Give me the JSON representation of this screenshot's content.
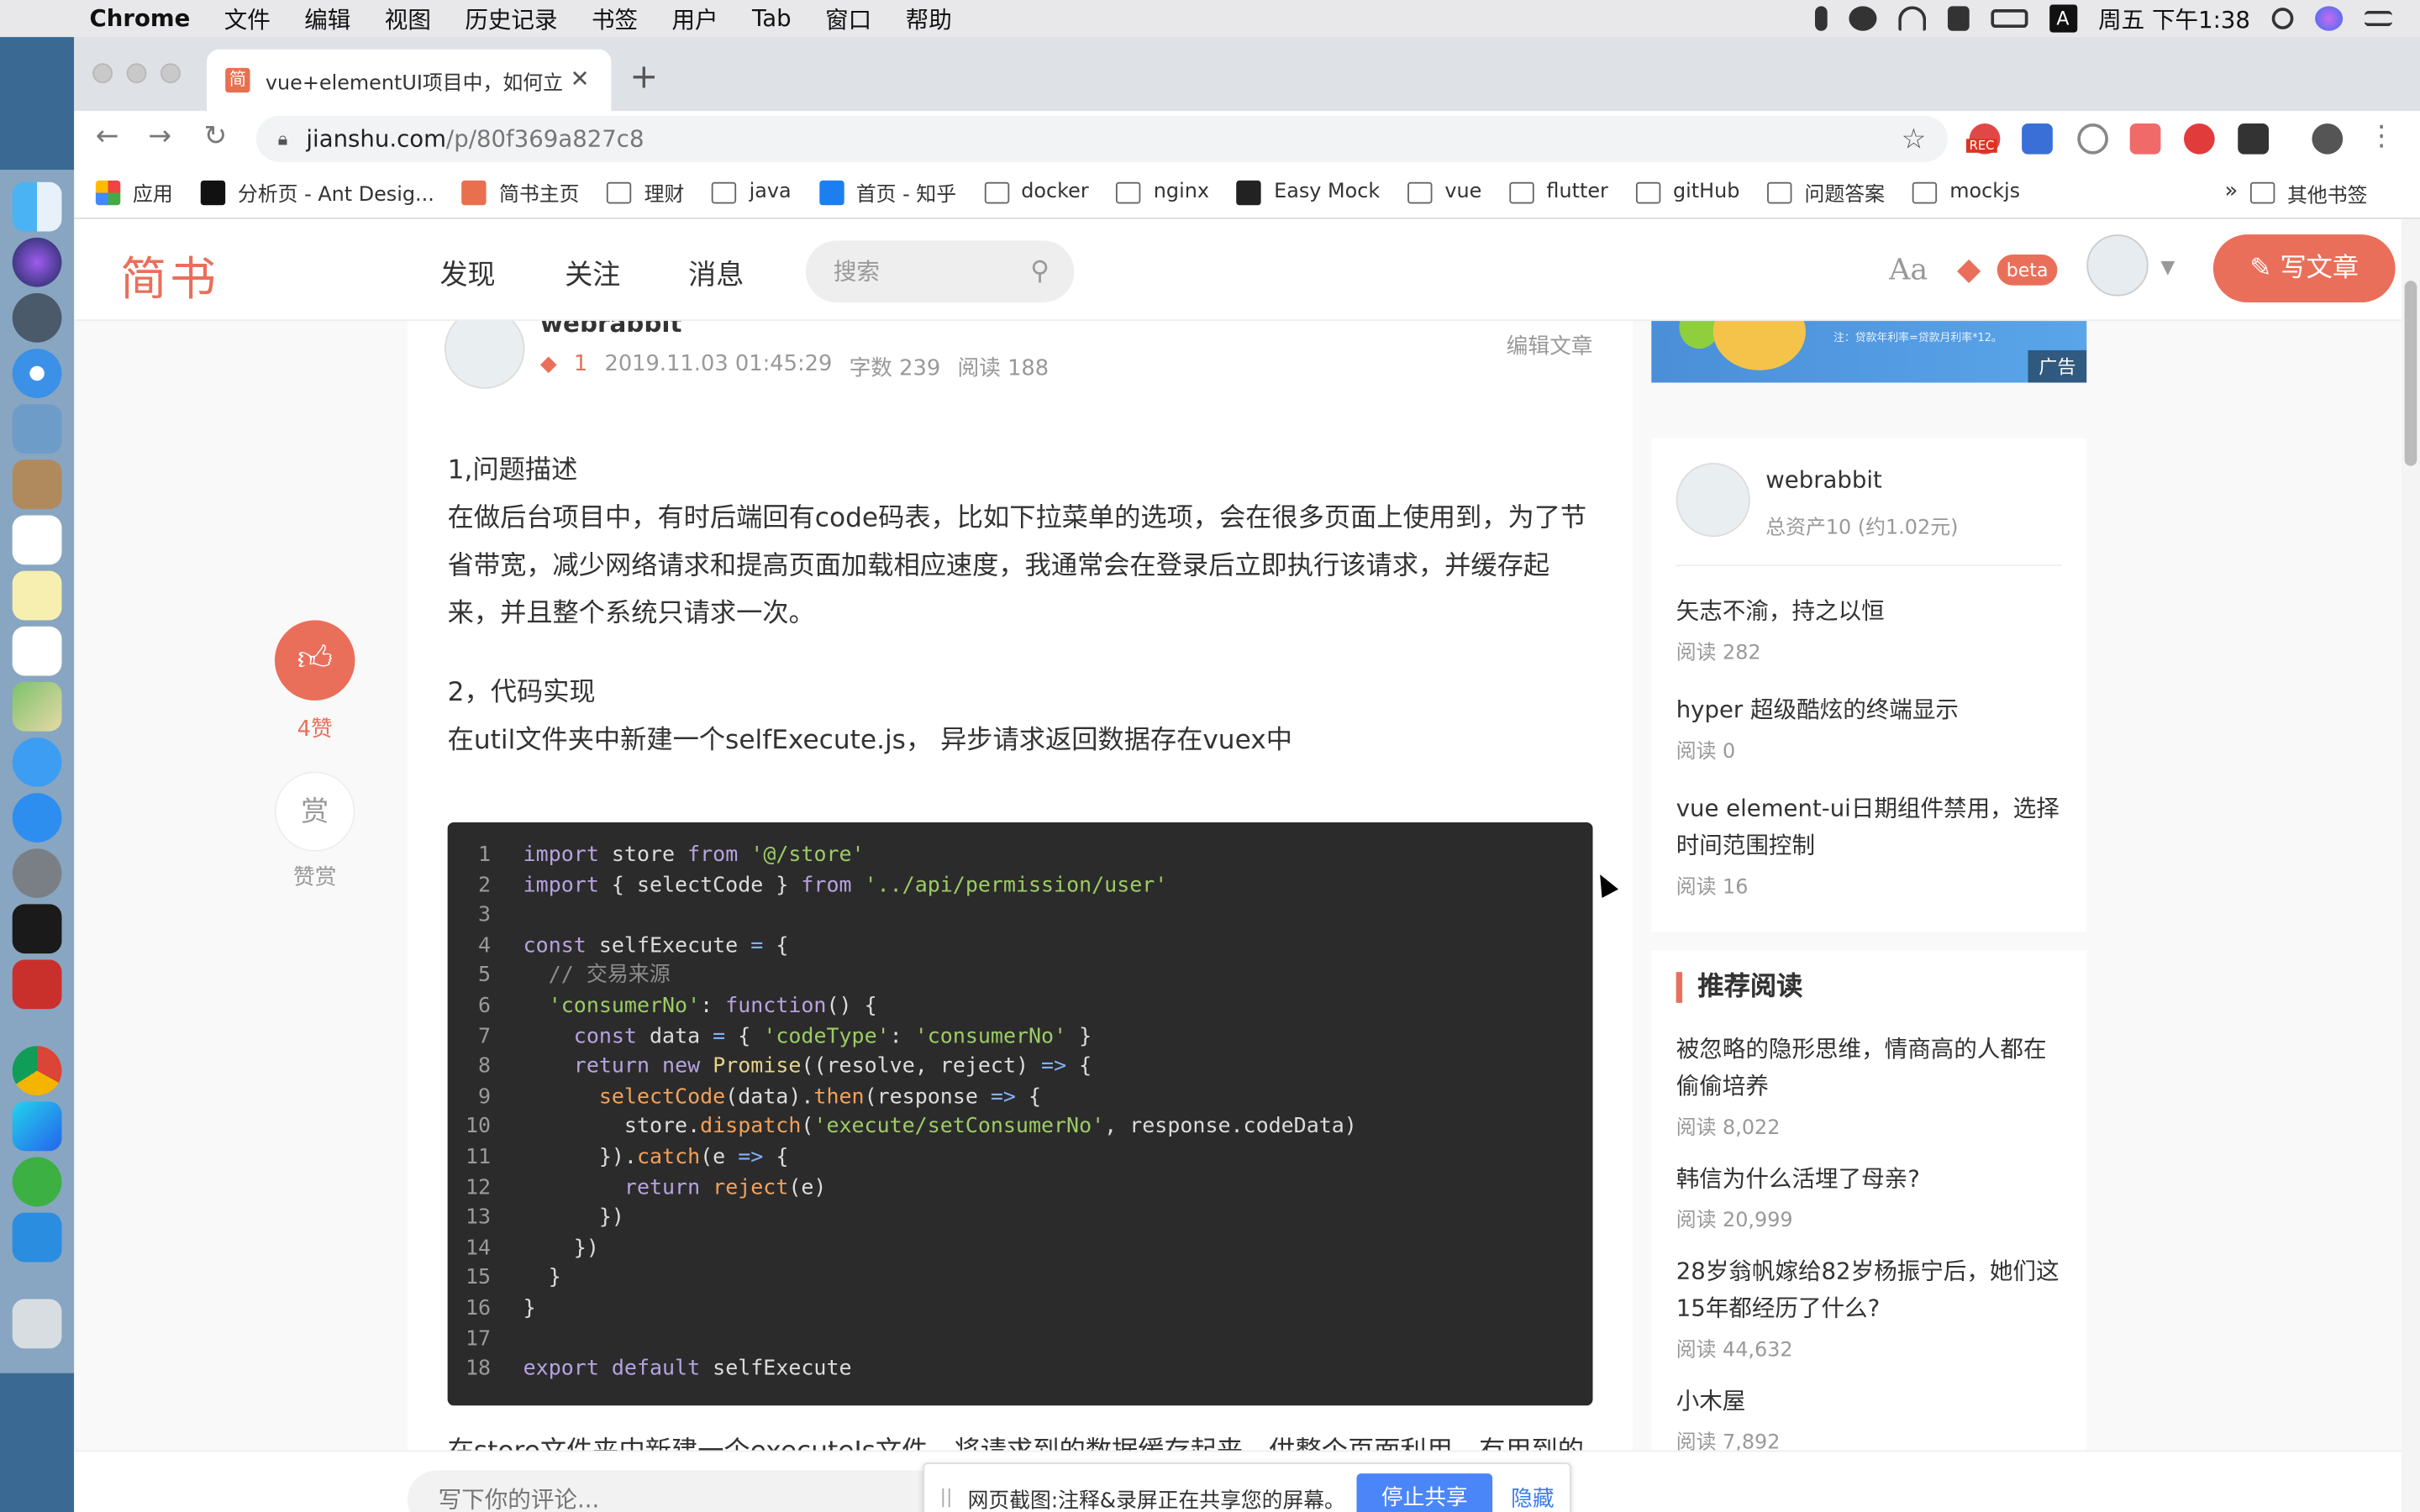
{
  "menubar": {
    "app": "Chrome",
    "items": [
      "文件",
      "编辑",
      "视图",
      "历史记录",
      "书签",
      "用户",
      "Tab",
      "窗口",
      "帮助"
    ],
    "clock": "周五 下午1:38",
    "input_badge": "A"
  },
  "browser": {
    "tab_title": "vue+elementUI项目中，如何立",
    "tab_favicon": "简",
    "new_tab": "+",
    "url_host": "jianshu.com",
    "url_path": "/p/80f369a827c8",
    "ext_rec_label": "REC",
    "bookmarks": [
      {
        "label": "应用",
        "kind": "apps"
      },
      {
        "label": "分析页 - Ant Desig...",
        "kind": "pro"
      },
      {
        "label": "简书主页",
        "kind": "jianshu"
      },
      {
        "label": "理财",
        "kind": "folder"
      },
      {
        "label": "java",
        "kind": "folder"
      },
      {
        "label": "首页 - 知乎",
        "kind": "zhihu"
      },
      {
        "label": "docker",
        "kind": "folder"
      },
      {
        "label": "nginx",
        "kind": "folder"
      },
      {
        "label": "Easy Mock",
        "kind": "mock"
      },
      {
        "label": "vue",
        "kind": "folder"
      },
      {
        "label": "flutter",
        "kind": "folder"
      },
      {
        "label": "gitHub",
        "kind": "folder"
      },
      {
        "label": "问题答案",
        "kind": "folder"
      },
      {
        "label": "mockjs",
        "kind": "folder"
      }
    ],
    "bookmarks_more": "»",
    "bookmarks_other": "其他书签"
  },
  "site": {
    "logo": "简书",
    "nav": [
      "发现",
      "关注",
      "消息"
    ],
    "search_placeholder": "搜索",
    "aa": "Aa",
    "beta": "beta",
    "write": "写文章"
  },
  "article": {
    "author": "webrabbit",
    "diamond": "1",
    "date": "2019.11.03 01:45:29",
    "words": "字数 239",
    "reads": "阅读 188",
    "edit": "编辑文章",
    "p1_title": "1,问题描述",
    "p1_body": "在做后台项目中，有时后端回有code码表，比如下拉菜单的选项，会在很多页面上使用到，为了节省带宽，减少网络请求和提高页面加载相应速度，我通常会在登录后立即执行该请求，并缓存起来，并且整个系统只请求一次。",
    "p2_title": "2，代码实现",
    "p2_body": "在util文件夹中新建一个selfExecute.js， 异步请求返回数据存在vuex中",
    "tail_text": "在store文件夹中新建一个executeJs文件，将请求到的数据缓存起来，供整个页面利用，有用到的"
  },
  "code_lines": [
    {
      "n": "1",
      "html": "<span class=\"kw\">import</span> store <span class=\"kw\">from</span> <span class=\"st\">'@/store'</span>"
    },
    {
      "n": "2",
      "html": "<span class=\"kw\">import</span> { selectCode } <span class=\"kw\">from</span> <span class=\"st\">'../api/permission/user'</span>"
    },
    {
      "n": "3",
      "html": ""
    },
    {
      "n": "4",
      "html": "<span class=\"kw\">const</span> selfExecute <span class=\"op\">=</span> {"
    },
    {
      "n": "5",
      "html": "  <span class=\"cm\">// 交易来源</span>"
    },
    {
      "n": "6",
      "html": "  <span class=\"st\">'consumerNo'</span>: <span class=\"kw\">function</span>() {"
    },
    {
      "n": "7",
      "html": "    <span class=\"kw\">const</span> data <span class=\"op\">=</span> { <span class=\"st\">'codeType'</span>: <span class=\"st\">'consumerNo'</span> }"
    },
    {
      "n": "8",
      "html": "    <span class=\"kw\">return</span> <span class=\"kw\">new</span> <span class=\"yl\">Promise</span>((resolve, reject) <span class=\"op\">=&gt;</span> {"
    },
    {
      "n": "9",
      "html": "      <span class=\"fn\">selectCode</span>(data).<span class=\"fn\">then</span>(response <span class=\"op\">=&gt;</span> {"
    },
    {
      "n": "10",
      "html": "        store.<span class=\"fn\">dispatch</span>(<span class=\"st\">'execute/setConsumerNo'</span>, response.codeData)"
    },
    {
      "n": "11",
      "html": "      }).<span class=\"fn\">catch</span>(e <span class=\"op\">=&gt;</span> {"
    },
    {
      "n": "12",
      "html": "        <span class=\"kw\">return</span> <span class=\"fn\">reject</span>(e)"
    },
    {
      "n": "13",
      "html": "      })"
    },
    {
      "n": "14",
      "html": "    })"
    },
    {
      "n": "15",
      "html": "  }"
    },
    {
      "n": "16",
      "html": "}"
    },
    {
      "n": "17",
      "html": ""
    },
    {
      "n": "18",
      "html": "<span class=\"kw\">export</span> <span class=\"kw\">default</span> selfExecute"
    }
  ],
  "like": {
    "icon": "thumbs-up",
    "count": "4赞",
    "reward": "赏",
    "reward_label": "赞赏"
  },
  "ad": {
    "label": "广告",
    "tiny": "注：贷款年利率=贷款月利率*12。"
  },
  "author_card": {
    "name": "webrabbit",
    "assets": "总资产10 (约1.02元)",
    "items": [
      {
        "title": "矢志不渝，持之以恒",
        "reads": "阅读 282"
      },
      {
        "title": "hyper 超级酷炫的终端显示",
        "reads": "阅读 0"
      },
      {
        "title": "vue element-ui日期组件禁用，选择时间范围控制",
        "reads": "阅读 16"
      }
    ]
  },
  "recommend": {
    "title": "推荐阅读",
    "items": [
      {
        "title": "被忽略的隐形思维，情商高的人都在偷偷培养",
        "reads": "阅读 8,022"
      },
      {
        "title": "韩信为什么活埋了母亲?",
        "reads": "阅读 20,999"
      },
      {
        "title": "28岁翁帆嫁给82岁杨振宁后，她们这15年都经历了什么?",
        "reads": "阅读 44,632"
      },
      {
        "title": "小木屋",
        "reads": "阅读 7,892"
      }
    ]
  },
  "comment": {
    "placeholder": "写下你的评论..."
  },
  "share_bar": {
    "grip": "||",
    "message": "网页截图:注释&录屏正在共享您的屏幕。",
    "stop": "停止共享",
    "hide": "隐藏"
  },
  "colors": {
    "brand": "#ea6f5a",
    "share_blue": "#4a86f7"
  }
}
